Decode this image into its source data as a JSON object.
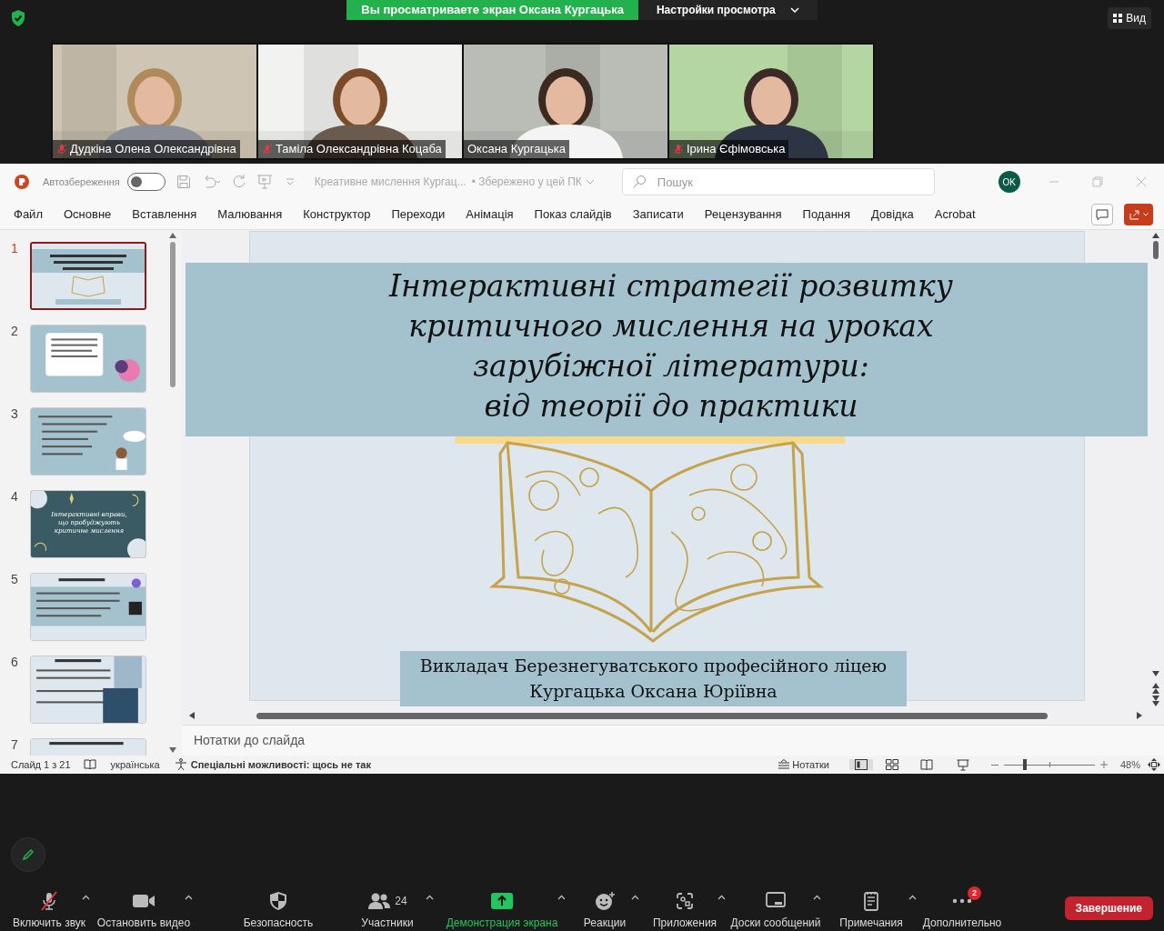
{
  "zoom_top": {
    "banner": "Вы просматриваете экран Оксана Кургацька",
    "view_settings": "Настройки просмотра",
    "view_button": "Вид"
  },
  "participants": [
    {
      "name": "Дудкіна Олена Олександрівна",
      "muted": true,
      "speaking": false
    },
    {
      "name": "Таміла Олександрівна Коцаба",
      "muted": true,
      "speaking": false
    },
    {
      "name": "Оксана Кургацька",
      "muted": false,
      "speaking": true
    },
    {
      "name": "Ірина Єфімовська",
      "muted": true,
      "speaking": false
    }
  ],
  "powerpoint": {
    "autosave_label": "Автозбереження",
    "autosave_on": false,
    "document_title": "Креативне мислення Кургац...",
    "save_status": "• Збережено у цей ПК",
    "search_placeholder": "Пошук",
    "avatar": "OK",
    "ribbon_tabs": [
      "Файл",
      "Основне",
      "Вставлення",
      "Малювання",
      "Конструктор",
      "Переходи",
      "Анімація",
      "Показ слайдів",
      "Записати",
      "Рецензування",
      "Подання",
      "Довідка",
      "Acrobat"
    ],
    "slide_thumbnails": [
      {
        "number": "1",
        "selected": true,
        "kind": "title"
      },
      {
        "number": "2",
        "selected": false,
        "kind": "card"
      },
      {
        "number": "3",
        "selected": false,
        "kind": "list"
      },
      {
        "number": "4",
        "selected": false,
        "kind": "dark",
        "title": "Інтерактивні вправи, що пробуджують критичне мислення"
      },
      {
        "number": "5",
        "selected": false,
        "kind": "problem"
      },
      {
        "number": "6",
        "selected": false,
        "kind": "illustrations"
      },
      {
        "number": "7",
        "selected": false,
        "kind": "cut"
      }
    ],
    "slide": {
      "title_lines": [
        "Інтерактивні стратегії розвитку",
        "критичного мислення на уроках",
        "зарубіжної літератури:",
        "від теорії до практики"
      ],
      "caption_lines": [
        "Викладач Березнегуватського професійного ліцею",
        "Кургацька Оксана Юріївна"
      ]
    },
    "notes_placeholder": "Нотатки до слайда",
    "status_bar": {
      "slide_count": "Слайд 1 з 21",
      "language": "українська",
      "accessibility": "Спеціальні можливості: щось не так",
      "notes_button": "Нотатки",
      "zoom": {
        "level": 0.22
      },
      "zoom_reading": "48%"
    }
  },
  "toolbar": {
    "items": [
      {
        "kind": "mic-off",
        "label": "Включить звук",
        "caret": true,
        "highlighted": false
      },
      {
        "kind": "camera",
        "label": "Остановить видео",
        "caret": true,
        "highlighted": false
      },
      {
        "kind": "shield",
        "label": "Безопасность",
        "caret": false,
        "highlighted": false
      },
      {
        "kind": "people",
        "label": "Участники",
        "caret": true,
        "highlighted": false,
        "count": "24"
      },
      {
        "kind": "share",
        "label": "Демонстрация экрана",
        "caret": true,
        "highlighted": true
      },
      {
        "kind": "smile",
        "label": "Реакции",
        "caret": true,
        "highlighted": false
      },
      {
        "kind": "apps",
        "label": "Приложения",
        "caret": true,
        "highlighted": false
      },
      {
        "kind": "board",
        "label": "Доски сообщений",
        "caret": true,
        "highlighted": false
      },
      {
        "kind": "notes",
        "label": "Примечания",
        "caret": true,
        "highlighted": false
      },
      {
        "kind": "more",
        "label": "Дополнительно",
        "caret": false,
        "highlighted": false,
        "badge": "2"
      }
    ],
    "end_button": "Завершение"
  }
}
